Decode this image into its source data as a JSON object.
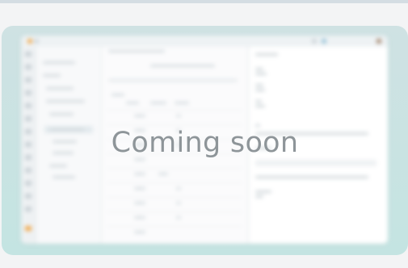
{
  "overlay": {
    "message": "Coming soon"
  },
  "colors": {
    "page_background": "#f3f4f5",
    "card_gradient_top": "#cfe2e3",
    "card_gradient_bottom": "#c4e4e2",
    "overlay_text": "#8e9599"
  },
  "preview": {
    "state": "blurred",
    "app_icon": "orange-square-icon"
  }
}
